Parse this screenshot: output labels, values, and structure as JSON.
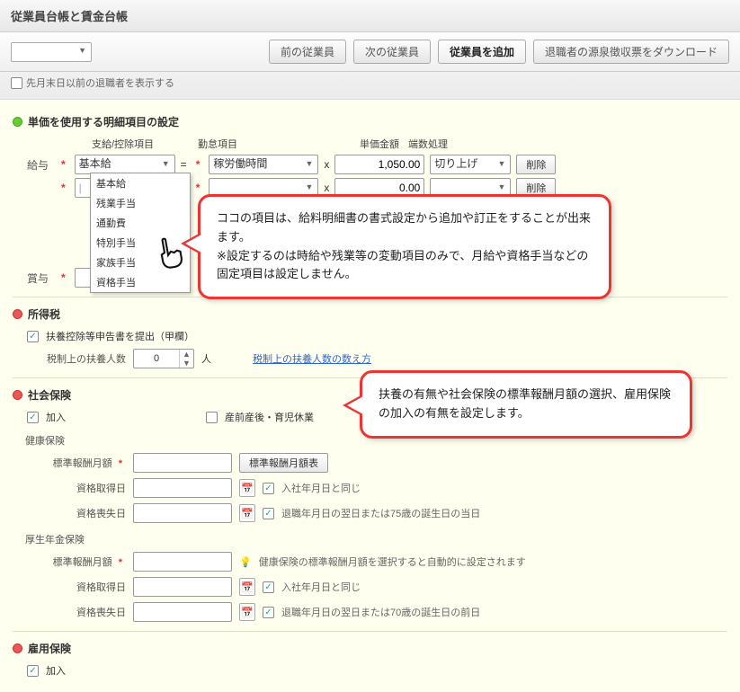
{
  "title": "従業員台帳と賃金台帳",
  "toolbar": {
    "prev": "前の従業員",
    "next": "次の従業員",
    "add": "従業員を追加",
    "download": "退職者の源泉徴収票をダウンロード",
    "show_retired": "先月末日以前の退職者を表示する"
  },
  "unit_price": {
    "heading": "単価を使用する明細項目の設定",
    "cols": {
      "item": "支給/控除項目",
      "work": "勤怠項目",
      "unit": "単価金額",
      "round": "端数処理"
    },
    "row1_label": "給与",
    "row1": {
      "item": "基本給",
      "work": "稼労働時間",
      "unit": "1,050.00",
      "round": "切り上げ"
    },
    "row2": {
      "item": "",
      "work": "",
      "unit": "0.00",
      "round": ""
    },
    "bonus_label": "賞与",
    "delete": "削除",
    "options": [
      "基本給",
      "残業手当",
      "通勤費",
      "特別手当",
      "家族手当",
      "資格手当"
    ]
  },
  "callouts": {
    "c1": "ココの項目は、給料明細書の書式設定から追加や訂正をすることが出来ます。\n※設定するのは時給や残業等の変動項目のみで、月給や資格手当などの固定項目は設定しません。",
    "c2": "扶養の有無や社会保険の標準報酬月額の選択、雇用保険の加入の有無を設定します。"
  },
  "income_tax": {
    "heading": "所得税",
    "declare": "扶養控除等申告書を提出（甲欄）",
    "dependents_label": "税制上の扶養人数",
    "dependents_value": "0",
    "dependents_unit": "人",
    "link": "税制上の扶養人数の数え方"
  },
  "social": {
    "heading": "社会保険",
    "enroll": "加入",
    "maternity": "産前産後・育児休業",
    "health": "健康保険",
    "std_month_label": "標準報酬月額",
    "std_month_btn": "標準報酬月額表",
    "acq_date": "資格取得日",
    "loss_date": "資格喪失日",
    "same_as_hire": "入社年月日と同じ",
    "loss_health_note": "退職年月日の翌日または75歳の誕生日の当日",
    "pension": "厚生年金保険",
    "pension_note": "健康保険の標準報酬月額を選択すると自動的に設定されます",
    "loss_pension_note": "退職年月日の翌日または70歳の誕生日の前日"
  },
  "employment": {
    "heading": "雇用保険",
    "enroll": "加入"
  },
  "symbols": {
    "eq": "=",
    "mul": "x",
    "req": "*"
  }
}
